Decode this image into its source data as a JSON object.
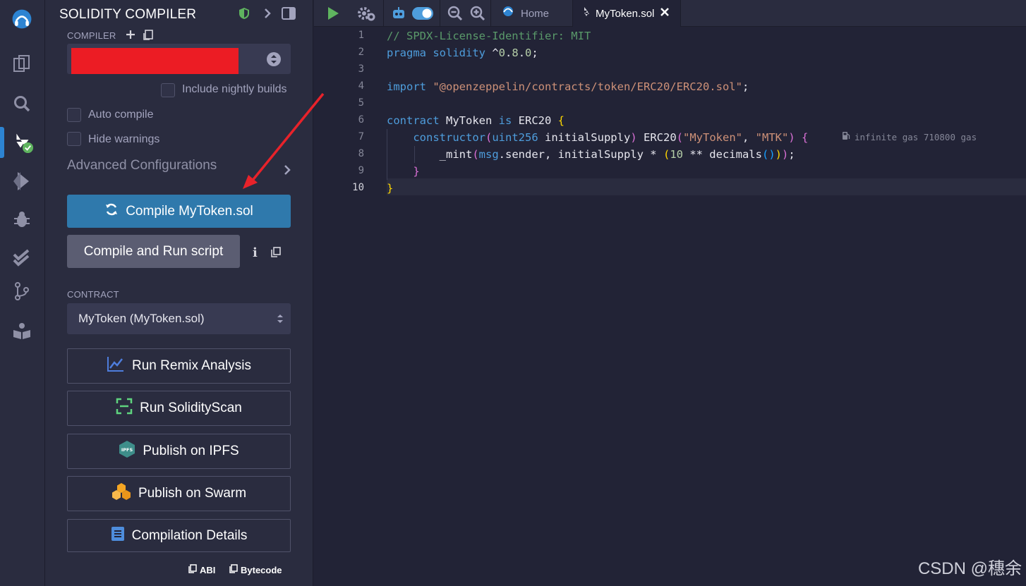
{
  "panel": {
    "title": "SOLIDITY COMPILER",
    "compiler_label": "COMPILER",
    "include_nightly": "Include nightly builds",
    "auto_compile": "Auto compile",
    "hide_warnings": "Hide warnings",
    "advanced_config": "Advanced Configurations",
    "compile_button": "Compile MyToken.sol",
    "compile_run_button": "Compile and Run script",
    "contract_label": "CONTRACT",
    "contract_selected": "MyToken (MyToken.sol)",
    "run_remix_analysis": "Run Remix Analysis",
    "run_solidityscan": "Run SolidityScan",
    "publish_ipfs": "Publish on IPFS",
    "publish_swarm": "Publish on Swarm",
    "compilation_details": "Compilation Details",
    "abi": "ABI",
    "bytecode": "Bytecode"
  },
  "tabs": {
    "home": "Home",
    "active_file": "MyToken.sol"
  },
  "editor": {
    "line_numbers": [
      "1",
      "2",
      "3",
      "4",
      "5",
      "6",
      "7",
      "8",
      "9",
      "10"
    ],
    "active_line": "10",
    "gas_hint": "infinite gas 710800 gas",
    "lines": [
      "// SPDX-License-Identifier: MIT",
      "pragma solidity ^0.8.0;",
      "",
      "import \"@openzeppelin/contracts/token/ERC20/ERC20.sol\";",
      "",
      "contract MyToken is ERC20 {",
      "    constructor(uint256 initialSupply) ERC20(\"MyToken\", \"MTK\") {",
      "        _mint(msg.sender, initialSupply * (10 ** decimals()));",
      "    }",
      "}"
    ]
  },
  "watermark": "CSDN @穗余",
  "colors": {
    "primary_button": "#2f79ac",
    "annotation_arrow": "#e8222a",
    "redaction": "#ec1c24"
  },
  "icons": [
    "remix-logo-icon",
    "file-explorer-icon",
    "search-icon",
    "solidity-compiler-icon",
    "deploy-icon",
    "debugger-icon",
    "test-icon",
    "git-icon",
    "learn-icon",
    "run-icon",
    "settings-icon",
    "copilot-icon",
    "toggle-icon",
    "zoom-out-icon",
    "zoom-in-icon",
    "home-icon",
    "close-icon"
  ]
}
